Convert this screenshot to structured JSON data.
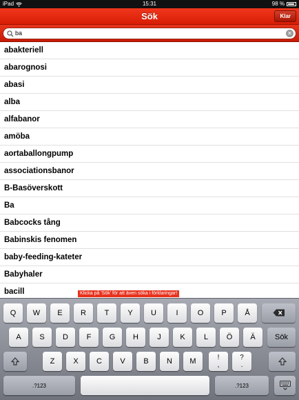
{
  "status_bar": {
    "carrier": "iPad",
    "time": "15:31",
    "battery": "98 %"
  },
  "nav": {
    "title": "Sök",
    "done_label": "Klar"
  },
  "search": {
    "value": "ba",
    "placeholder": ""
  },
  "results": [
    "abakteriell",
    "abarognosi",
    "abasi",
    "alba",
    "alfabanor",
    "amöba",
    "aortaballongpump",
    "associationsbanor",
    "B-Basöverskott",
    "Ba",
    "Babcocks tång",
    "Babinskis fenomen",
    "baby-feeding-kateter",
    "Babyhaler",
    "bacill"
  ],
  "hint": "Klicka på 'Sök' för att även söka i förklaringar!",
  "keyboard": {
    "row1": [
      "Q",
      "W",
      "E",
      "R",
      "T",
      "Y",
      "U",
      "I",
      "O",
      "P",
      "Å"
    ],
    "row2": [
      "A",
      "S",
      "D",
      "F",
      "G",
      "H",
      "J",
      "K",
      "L",
      "Ö",
      "Ä"
    ],
    "row3": [
      "Z",
      "X",
      "C",
      "V",
      "B",
      "N",
      "M"
    ],
    "search_key": "Sök",
    "punct1": {
      "top": "!",
      "bottom": ","
    },
    "punct2": {
      "top": "?",
      "bottom": "."
    },
    "numbers_label": ".?123",
    "icons": {
      "backspace": "backspace-icon",
      "shift": "shift-icon",
      "hide_keyboard": "keyboard-hide-icon"
    }
  },
  "colors": {
    "accent": "#e02a12",
    "keyboard": "#8b8e96"
  }
}
